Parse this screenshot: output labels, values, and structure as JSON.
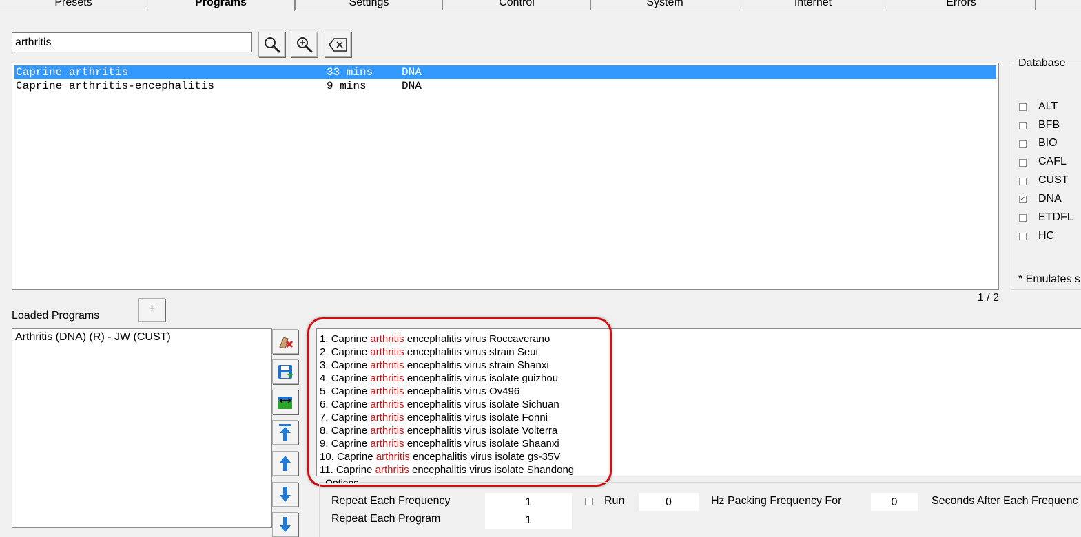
{
  "tabs": [
    "Presets",
    "Programs",
    "Settings",
    "Control",
    "System",
    "Internet",
    "Errors"
  ],
  "active_tab": "Programs",
  "search": {
    "value": "arthritis"
  },
  "results": [
    {
      "name": "Caprine arthritis",
      "duration": "33 mins",
      "db": "DNA",
      "selected": true
    },
    {
      "name": "Caprine arthritis-encephalitis",
      "duration": "9 mins",
      "db": "DNA",
      "selected": false
    }
  ],
  "pager": "1 / 2",
  "database": {
    "title": "Database",
    "items": [
      {
        "label": "ALT",
        "checked": false
      },
      {
        "label": "BFB",
        "checked": false
      },
      {
        "label": "BIO",
        "checked": false
      },
      {
        "label": "CAFL",
        "checked": false
      },
      {
        "label": "CUST",
        "checked": false
      },
      {
        "label": "DNA",
        "checked": true
      },
      {
        "label": "ETDFL",
        "checked": false
      },
      {
        "label": "HC",
        "checked": false
      }
    ],
    "footnote": "* Emulates s"
  },
  "loaded": {
    "label": "Loaded Programs",
    "add_label": "+",
    "items": [
      "Arthritis (DNA) (R) - JW (CUST)"
    ]
  },
  "description": {
    "highlight_word": "arthritis",
    "lines": [
      {
        "num": "1.",
        "pre": "Caprine",
        "post": "encephalitis virus Roccaverano"
      },
      {
        "num": "2.",
        "pre": "Caprine",
        "post": "encephalitis virus strain Seui"
      },
      {
        "num": "3.",
        "pre": "Caprine",
        "post": "encephalitis virus strain Shanxi"
      },
      {
        "num": "4.",
        "pre": "Caprine",
        "post": "encephalitis virus isolate guizhou"
      },
      {
        "num": "5.",
        "pre": "Caprine",
        "post": "encephalitis virus Ov496"
      },
      {
        "num": "6.",
        "pre": "Caprine",
        "post": "encephalitis virus isolate Sichuan"
      },
      {
        "num": "7.",
        "pre": "Caprine",
        "post": "encephalitis virus isolate Fonni"
      },
      {
        "num": "8.",
        "pre": "Caprine",
        "post": "encephalitis virus isolate Volterra"
      },
      {
        "num": "9.",
        "pre": "Caprine",
        "post": "encephalitis virus isolate Shaanxi"
      },
      {
        "num": "10.",
        "pre": "Caprine",
        "post": "encephalitis virus isolate gs-35V"
      },
      {
        "num": "11.",
        "pre": "Caprine",
        "post": "encephalitis virus isolate Shandong"
      }
    ]
  },
  "options": {
    "title": "Options",
    "repeat_frequency_label": "Repeat Each Frequency",
    "repeat_frequency_value": "1",
    "repeat_program_label": "Repeat Each Program",
    "repeat_program_value": "1",
    "run_label": "Run",
    "run_value": "0",
    "hz_label": "Hz Packing Frequency For",
    "seconds_value": "0",
    "seconds_label": "Seconds After Each Frequenc"
  },
  "colors": {
    "selection": "#3399ff",
    "highlight": "#cc1111",
    "callout": "#d01010"
  },
  "icons": [
    "search-icon",
    "zoom-in-icon",
    "clear-icon",
    "delete-icon",
    "save-icon",
    "swap-icon",
    "move-top-icon",
    "move-up-icon",
    "move-down-icon"
  ]
}
